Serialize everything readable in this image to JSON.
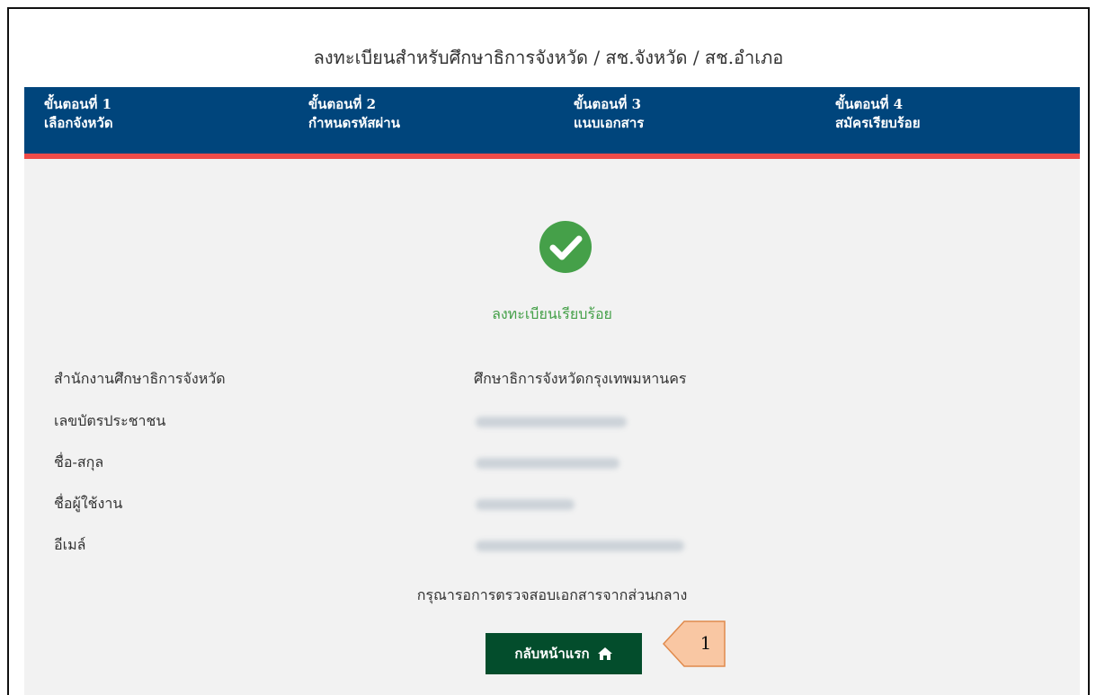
{
  "page_title": "ลงทะเบียนสำหรับศึกษาธิการจังหวัด / สช.จังหวัด / สช.อำเภอ",
  "steps": [
    {
      "number": "ขั้นตอนที่ 1",
      "label": "เลือกจังหวัด"
    },
    {
      "number": "ขั้นตอนที่ 2",
      "label": "กำหนดรหัสผ่าน"
    },
    {
      "number": "ขั้นตอนที่ 3",
      "label": "แนบเอกสาร"
    },
    {
      "number": "ขั้นตอนที่ 4",
      "label": "สมัครเรียบร้อย"
    }
  ],
  "colors": {
    "steps_bar": "#00457c",
    "steps_underline": "#ef4b48",
    "success": "#45a049",
    "button": "#034d2c",
    "content_bg": "#f2f2f2",
    "callout_fill": "#f9c7a3",
    "callout_stroke": "#e08a4c"
  },
  "success": {
    "icon": "check-circle-icon",
    "message": "ลงทะเบียนเรียบร้อย"
  },
  "details": [
    {
      "label": "สำนักงานศึกษาธิการจังหวัด",
      "value": "ศึกษาธิการจังหวัดกรุงเทพมหานคร"
    },
    {
      "label": "เลขบัตรประชาชน"
    },
    {
      "label": "ชื่อ-สกุล"
    },
    {
      "label": "ชื่อผู้ใช้งาน"
    },
    {
      "label": "อีเมล์"
    }
  ],
  "note": "กรุณารอการตรวจสอบเอกสารจากส่วนกลาง",
  "home_button": {
    "label": "กลับหน้าแรก",
    "icon": "home-icon"
  },
  "callout": {
    "number": "1"
  }
}
